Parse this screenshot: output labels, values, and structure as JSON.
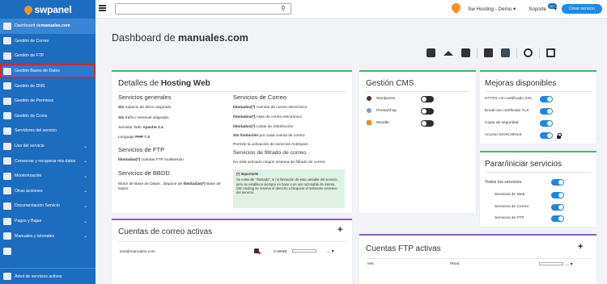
{
  "brand": {
    "name": "swpanel"
  },
  "sidebar": {
    "items": [
      {
        "prefix": "Dashboard de ",
        "bold": "manuales.com",
        "chev": ""
      },
      {
        "label": "Gestión de Correo",
        "chev": ""
      },
      {
        "label": "Gestión de FTP",
        "chev": ""
      },
      {
        "label": "Gestión Bases de Datos",
        "chev": ""
      },
      {
        "label": "Gestión de DNS",
        "chev": ""
      },
      {
        "label": "Gestión de Permisos",
        "chev": ""
      },
      {
        "label": "Gestión de Crons",
        "chev": ""
      },
      {
        "label": "Servidores del servicio",
        "chev": ""
      },
      {
        "label": "Uso del servicio",
        "chev": "⌄"
      },
      {
        "label": "Conservar y recuperar mis datos",
        "chev": "⌄"
      },
      {
        "label": "Monitorización",
        "chev": "⌄"
      },
      {
        "label": "Otras acciones",
        "chev": "⌄"
      },
      {
        "label": "Documentación Servicio",
        "chev": "⌄"
      },
      {
        "label": "Pagos y Bajas",
        "chev": "⌄"
      },
      {
        "label": "Manuales y tutoriales",
        "chev": "⌄"
      },
      {
        "label": "",
        "chev": ""
      }
    ],
    "footer": "Árbol de servicios activos"
  },
  "topbar": {
    "search_value": "",
    "search_icon": "search-icon",
    "hosting": "Sw Hosting - Demo  ▾",
    "support": "Soporte",
    "support_badge": "16+",
    "support_caret": "▾",
    "create": "Crear servicio"
  },
  "page": {
    "title_prefix": "Dashboard de ",
    "title_bold": "manuales.com"
  },
  "details": {
    "title_prefix": "Detalles de ",
    "title_bold": "Hosting Web",
    "general": {
      "title": "Servicios generales",
      "lines": [
        {
          "b": "Sin",
          "t": " espacio de disco asignado."
        },
        {
          "b": "Sin",
          "t": " tráfico mensual asignado."
        },
        {
          "t": "Servidor Web ",
          "b2": "Apache 2.4"
        },
        {
          "t": "Lenguaje ",
          "b2": "PHP 7.4"
        }
      ]
    },
    "ftp": {
      "title": "Servicios de FTP",
      "line_b": "Ilimitadas(*)",
      "line_t": " cuentas FTP multisesión"
    },
    "bbdd": {
      "title": "Servicios de BBDD",
      "line_t": "Motor de Base de Datos , dispone de ",
      "line_b": "Ilimitadas(*)",
      "line_t2": " Base de",
      "line_t3": "Datos"
    },
    "mail": {
      "title": "Servicios de Correo",
      "lines": [
        {
          "b": "Ilimitadas(*)",
          "t": " cuentas de correo electrónico"
        },
        {
          "b": "Ilimitados(*)",
          "t": " Alias de correo electrónico"
        },
        {
          "b": "Ilimitados(*)",
          "t": " Listas de Distribución"
        },
        {
          "b": "Sin limitación",
          "t": " por cada cuenta de correo"
        },
        {
          "t": "Permite la activación de servicios AntiSpam"
        }
      ]
    },
    "filter": {
      "title": "Servicios de filtrado de correo",
      "line": "No está activado ningún sistema de filtrado de correo."
    },
    "important": {
      "title": "(*) Importante",
      "text": "Se entiende \"ilimitado\", si no limitación de esta variable del servicio, pero se establece siempre en base a un uso razonable de mismo. SW Hosting se reserva el derecho a bloquear el sobreuso excesivo del servicio."
    }
  },
  "cms": {
    "title": "Gestión CMS",
    "items": [
      {
        "label": "Wordpress",
        "on": false,
        "icon": "wordpress-icon",
        "color": "#3b3b3b"
      },
      {
        "label": "PrestaShop",
        "on": false,
        "icon": "prestashop-icon",
        "color": "#7f9ec2"
      },
      {
        "label": "Moodle",
        "on": false,
        "icon": "moodle-icon",
        "color": "#f08a1c"
      }
    ]
  },
  "improve": {
    "title": "Mejoras disponibles",
    "items": [
      {
        "label": "HTTPS con certificado SSL",
        "on": true
      },
      {
        "label": "Email con certificado TLS",
        "on": true
      },
      {
        "label": "Copia de seguridad",
        "on": true
      },
      {
        "label": "Acceso SSH/CHRoot",
        "on": true
      }
    ]
  },
  "services": {
    "title": "Parar/iniciar servicios",
    "all": "Todos los servicios",
    "items": [
      {
        "label": "Servicios de Web",
        "on": true
      },
      {
        "label": "Servicios de Correo",
        "on": true
      },
      {
        "label": "Servicios de FTP",
        "on": true
      }
    ]
  },
  "mail_accounts": {
    "title": "Cuentas de correo activas",
    "plus": "+",
    "row": {
      "email": "test@manuales.com",
      "size": "0.00MB",
      "more": "...  ▾"
    }
  },
  "ftp_accounts": {
    "title": "Cuentas FTP activas",
    "plus": "+",
    "row": {
      "user": "test",
      "path": "\\Root",
      "more": "...  ▾"
    }
  },
  "colors": {
    "sidebar": "#1c6cc0",
    "accent": "#1f86e0",
    "green": "#48b86c",
    "purple": "#8b5ec4",
    "highlight": "#d7262e"
  }
}
